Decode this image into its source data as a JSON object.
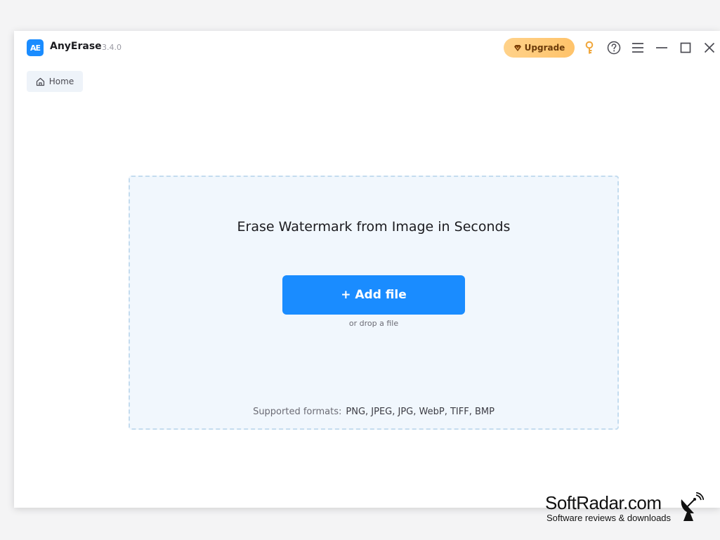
{
  "app": {
    "logo_text": "AE",
    "name": "AnyErase",
    "version": "3.4.0"
  },
  "titlebar": {
    "upgrade_label": "Upgrade",
    "icons": [
      "key-icon",
      "help-icon",
      "menu-icon",
      "minimize-icon",
      "maximize-icon",
      "close-icon"
    ]
  },
  "breadcrumb": {
    "home_label": "Home"
  },
  "dropzone": {
    "headline": "Erase Watermark from Image in Seconds",
    "add_button_label": "+ Add file",
    "drop_hint": "or drop a file",
    "formats_label": "Supported formats:",
    "formats_list": "PNG, JPEG, JPG, WebP, TIFF, BMP"
  },
  "watermark": {
    "title": "SoftRadar.com",
    "subtitle": "Software reviews & downloads"
  },
  "colors": {
    "accent": "#1a8cff",
    "upgrade": "#ffc36a",
    "key": "#f0a63a",
    "dropzone_bg": "#f1f7fd"
  }
}
